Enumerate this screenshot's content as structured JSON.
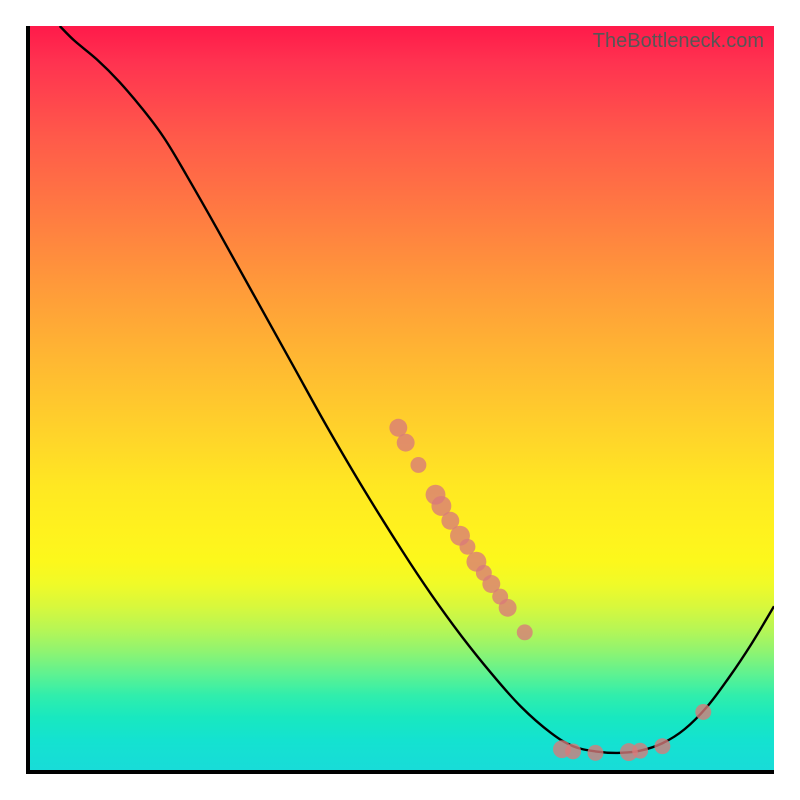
{
  "attribution": "TheBottleneck.com",
  "chart_data": {
    "type": "line",
    "title": "",
    "xlabel": "",
    "ylabel": "",
    "xlim": [
      0,
      100
    ],
    "ylim": [
      0,
      100
    ],
    "curve": [
      {
        "x": 4,
        "y": 100
      },
      {
        "x": 6,
        "y": 98
      },
      {
        "x": 9,
        "y": 95.5
      },
      {
        "x": 12,
        "y": 92.5
      },
      {
        "x": 15,
        "y": 89
      },
      {
        "x": 18,
        "y": 85
      },
      {
        "x": 21,
        "y": 80
      },
      {
        "x": 25,
        "y": 73
      },
      {
        "x": 30,
        "y": 64
      },
      {
        "x": 35,
        "y": 55
      },
      {
        "x": 40,
        "y": 46
      },
      {
        "x": 45,
        "y": 37.5
      },
      {
        "x": 50,
        "y": 29.5
      },
      {
        "x": 54,
        "y": 23.5
      },
      {
        "x": 58,
        "y": 18
      },
      {
        "x": 62,
        "y": 13
      },
      {
        "x": 66,
        "y": 8.5
      },
      {
        "x": 70,
        "y": 5
      },
      {
        "x": 73,
        "y": 3.2
      },
      {
        "x": 76,
        "y": 2.5
      },
      {
        "x": 79,
        "y": 2.3
      },
      {
        "x": 82,
        "y": 2.6
      },
      {
        "x": 85,
        "y": 3.6
      },
      {
        "x": 88,
        "y": 5.5
      },
      {
        "x": 91,
        "y": 8.5
      },
      {
        "x": 94,
        "y": 12.5
      },
      {
        "x": 97,
        "y": 17
      },
      {
        "x": 100,
        "y": 22
      }
    ],
    "data_points": [
      {
        "x": 49.5,
        "y": 46,
        "r": 9
      },
      {
        "x": 50.5,
        "y": 44,
        "r": 9
      },
      {
        "x": 52.2,
        "y": 41,
        "r": 8
      },
      {
        "x": 54.5,
        "y": 37,
        "r": 10
      },
      {
        "x": 55.3,
        "y": 35.5,
        "r": 10
      },
      {
        "x": 56.5,
        "y": 33.5,
        "r": 9
      },
      {
        "x": 57.8,
        "y": 31.5,
        "r": 10
      },
      {
        "x": 58.8,
        "y": 30,
        "r": 8
      },
      {
        "x": 60.0,
        "y": 28,
        "r": 10
      },
      {
        "x": 61.0,
        "y": 26.5,
        "r": 8
      },
      {
        "x": 62.0,
        "y": 25,
        "r": 9
      },
      {
        "x": 63.2,
        "y": 23.3,
        "r": 8
      },
      {
        "x": 64.2,
        "y": 21.8,
        "r": 9
      },
      {
        "x": 66.5,
        "y": 18.5,
        "r": 8
      },
      {
        "x": 71.5,
        "y": 2.8,
        "r": 9
      },
      {
        "x": 73.0,
        "y": 2.5,
        "r": 8
      },
      {
        "x": 76.0,
        "y": 2.3,
        "r": 8
      },
      {
        "x": 80.5,
        "y": 2.4,
        "r": 9
      },
      {
        "x": 82.0,
        "y": 2.6,
        "r": 8
      },
      {
        "x": 85.0,
        "y": 3.2,
        "r": 8
      },
      {
        "x": 90.5,
        "y": 7.8,
        "r": 8
      }
    ]
  }
}
